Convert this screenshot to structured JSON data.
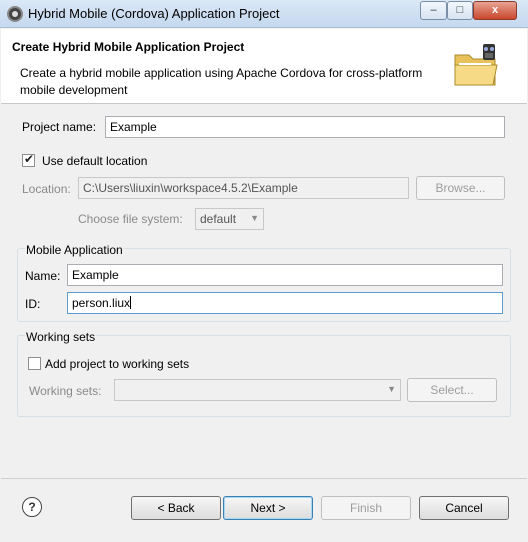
{
  "window": {
    "title": "Hybrid Mobile (Cordova) Application Project",
    "min_label": "‒",
    "max_label": "□",
    "close_label": "x"
  },
  "header": {
    "title": "Create Hybrid Mobile Application Project",
    "description": "Create a hybrid mobile application using Apache Cordova for cross-platform mobile development"
  },
  "project": {
    "name_label": "Project name:",
    "name_value": "Example",
    "use_default_label": "Use default location",
    "use_default_checked": true,
    "location_label": "Location:",
    "location_value": "C:\\Users\\liuxin\\workspace4.5.2\\Example",
    "browse_label": "Browse...",
    "file_system_label": "Choose file system:",
    "file_system_value": "default"
  },
  "mobile_app": {
    "group_label": "Mobile Application",
    "name_label": "Name:",
    "name_value": "Example",
    "id_label": "ID:",
    "id_value": "person.liux"
  },
  "working_sets": {
    "group_label": "Working sets",
    "add_label": "Add project to working sets",
    "add_checked": false,
    "sets_label": "Working sets:",
    "sets_value": "",
    "select_label": "Select..."
  },
  "footer": {
    "help_label": "?",
    "back_label": "< Back",
    "next_label": "Next >",
    "finish_label": "Finish",
    "cancel_label": "Cancel"
  }
}
